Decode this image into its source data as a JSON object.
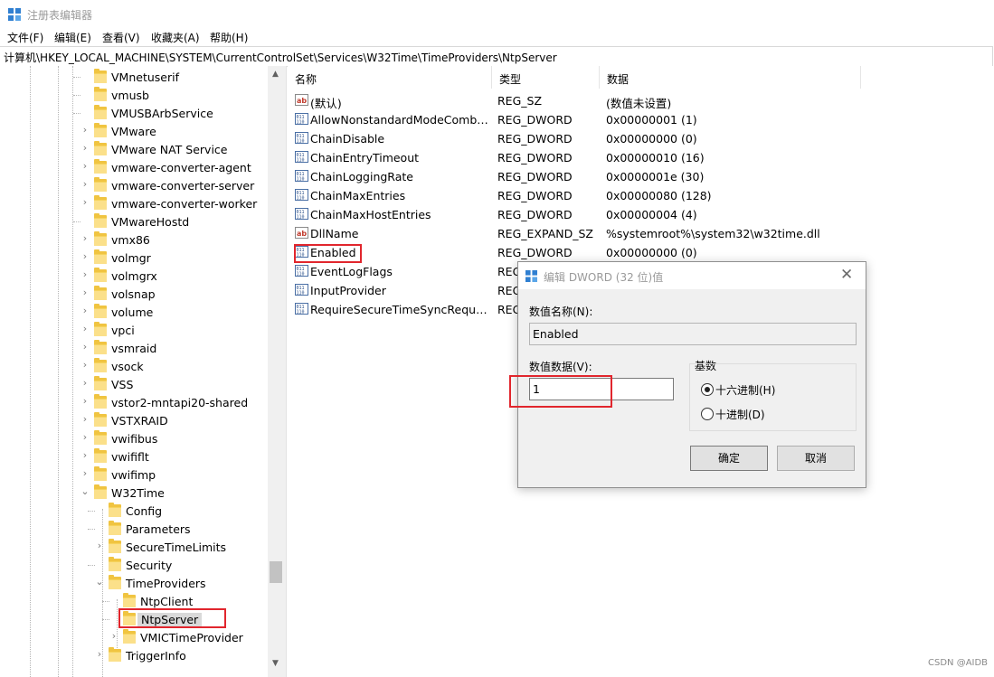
{
  "window": {
    "title": "注册表编辑器"
  },
  "menu": [
    "文件(F)",
    "编辑(E)",
    "查看(V)",
    "收藏夹(A)",
    "帮助(H)"
  ],
  "address": "计算机\\HKEY_LOCAL_MACHINE\\SYSTEM\\CurrentControlSet\\Services\\W32Time\\TimeProviders\\NtpServer",
  "tree": [
    {
      "label": "VMnetuserif",
      "level": 1,
      "chevron": "none"
    },
    {
      "label": "vmusb",
      "level": 1,
      "chevron": "none"
    },
    {
      "label": "VMUSBArbService",
      "level": 1,
      "chevron": "none"
    },
    {
      "label": "VMware",
      "level": 1,
      "chevron": "right"
    },
    {
      "label": "VMware NAT Service",
      "level": 1,
      "chevron": "right"
    },
    {
      "label": "vmware-converter-agent",
      "level": 1,
      "chevron": "right"
    },
    {
      "label": "vmware-converter-server",
      "level": 1,
      "chevron": "right"
    },
    {
      "label": "vmware-converter-worker",
      "level": 1,
      "chevron": "right"
    },
    {
      "label": "VMwareHostd",
      "level": 1,
      "chevron": "none"
    },
    {
      "label": "vmx86",
      "level": 1,
      "chevron": "right"
    },
    {
      "label": "volmgr",
      "level": 1,
      "chevron": "right"
    },
    {
      "label": "volmgrx",
      "level": 1,
      "chevron": "right"
    },
    {
      "label": "volsnap",
      "level": 1,
      "chevron": "right"
    },
    {
      "label": "volume",
      "level": 1,
      "chevron": "right"
    },
    {
      "label": "vpci",
      "level": 1,
      "chevron": "right"
    },
    {
      "label": "vsmraid",
      "level": 1,
      "chevron": "right"
    },
    {
      "label": "vsock",
      "level": 1,
      "chevron": "right"
    },
    {
      "label": "VSS",
      "level": 1,
      "chevron": "right"
    },
    {
      "label": "vstor2-mntapi20-shared",
      "level": 1,
      "chevron": "right"
    },
    {
      "label": "VSTXRAID",
      "level": 1,
      "chevron": "right"
    },
    {
      "label": "vwifibus",
      "level": 1,
      "chevron": "right"
    },
    {
      "label": "vwififlt",
      "level": 1,
      "chevron": "right"
    },
    {
      "label": "vwifimp",
      "level": 1,
      "chevron": "right"
    },
    {
      "label": "W32Time",
      "level": 1,
      "chevron": "down"
    },
    {
      "label": "Config",
      "level": 2,
      "chevron": "none"
    },
    {
      "label": "Parameters",
      "level": 2,
      "chevron": "none"
    },
    {
      "label": "SecureTimeLimits",
      "level": 2,
      "chevron": "right"
    },
    {
      "label": "Security",
      "level": 2,
      "chevron": "none"
    },
    {
      "label": "TimeProviders",
      "level": 2,
      "chevron": "down"
    },
    {
      "label": "NtpClient",
      "level": 3,
      "chevron": "none"
    },
    {
      "label": "NtpServer",
      "level": 3,
      "chevron": "none",
      "selected": true
    },
    {
      "label": "VMICTimeProvider",
      "level": 3,
      "chevron": "right"
    },
    {
      "label": "TriggerInfo",
      "level": 2,
      "chevron": "right"
    }
  ],
  "list": {
    "headers": {
      "name": "名称",
      "type": "类型",
      "data": "数据"
    },
    "rows": [
      {
        "icon": "ab",
        "name": "(默认)",
        "type": "REG_SZ",
        "data": "(数值未设置)"
      },
      {
        "icon": "bin",
        "name": "AllowNonstandardModeCombin...",
        "type": "REG_DWORD",
        "data": "0x00000001 (1)"
      },
      {
        "icon": "bin",
        "name": "ChainDisable",
        "type": "REG_DWORD",
        "data": "0x00000000 (0)"
      },
      {
        "icon": "bin",
        "name": "ChainEntryTimeout",
        "type": "REG_DWORD",
        "data": "0x00000010 (16)"
      },
      {
        "icon": "bin",
        "name": "ChainLoggingRate",
        "type": "REG_DWORD",
        "data": "0x0000001e (30)"
      },
      {
        "icon": "bin",
        "name": "ChainMaxEntries",
        "type": "REG_DWORD",
        "data": "0x00000080 (128)"
      },
      {
        "icon": "bin",
        "name": "ChainMaxHostEntries",
        "type": "REG_DWORD",
        "data": "0x00000004 (4)"
      },
      {
        "icon": "ab",
        "name": "DllName",
        "type": "REG_EXPAND_SZ",
        "data": "%systemroot%\\system32\\w32time.dll"
      },
      {
        "icon": "bin",
        "name": "Enabled",
        "type": "REG_DWORD",
        "data": "0x00000000 (0)"
      },
      {
        "icon": "bin",
        "name": "EventLogFlags",
        "type": "REG",
        "data": ""
      },
      {
        "icon": "bin",
        "name": "InputProvider",
        "type": "REG",
        "data": ""
      },
      {
        "icon": "bin",
        "name": "RequireSecureTimeSyncRequests",
        "type": "REG",
        "data": ""
      }
    ]
  },
  "dialog": {
    "title": "编辑 DWORD (32 位)值",
    "name_label": "数值名称(N):",
    "name_value": "Enabled",
    "value_label": "数值数据(V):",
    "value_value": "1",
    "base_label": "基数",
    "radio_hex": "十六进制(H)",
    "radio_dec": "十进制(D)",
    "base_selected": "hex",
    "ok": "确定",
    "cancel": "取消"
  },
  "watermark": "CSDN @AIDB",
  "colors": {
    "highlight": "#e1262d",
    "folder": "#f0c441",
    "selection": "#d9d9d9"
  }
}
